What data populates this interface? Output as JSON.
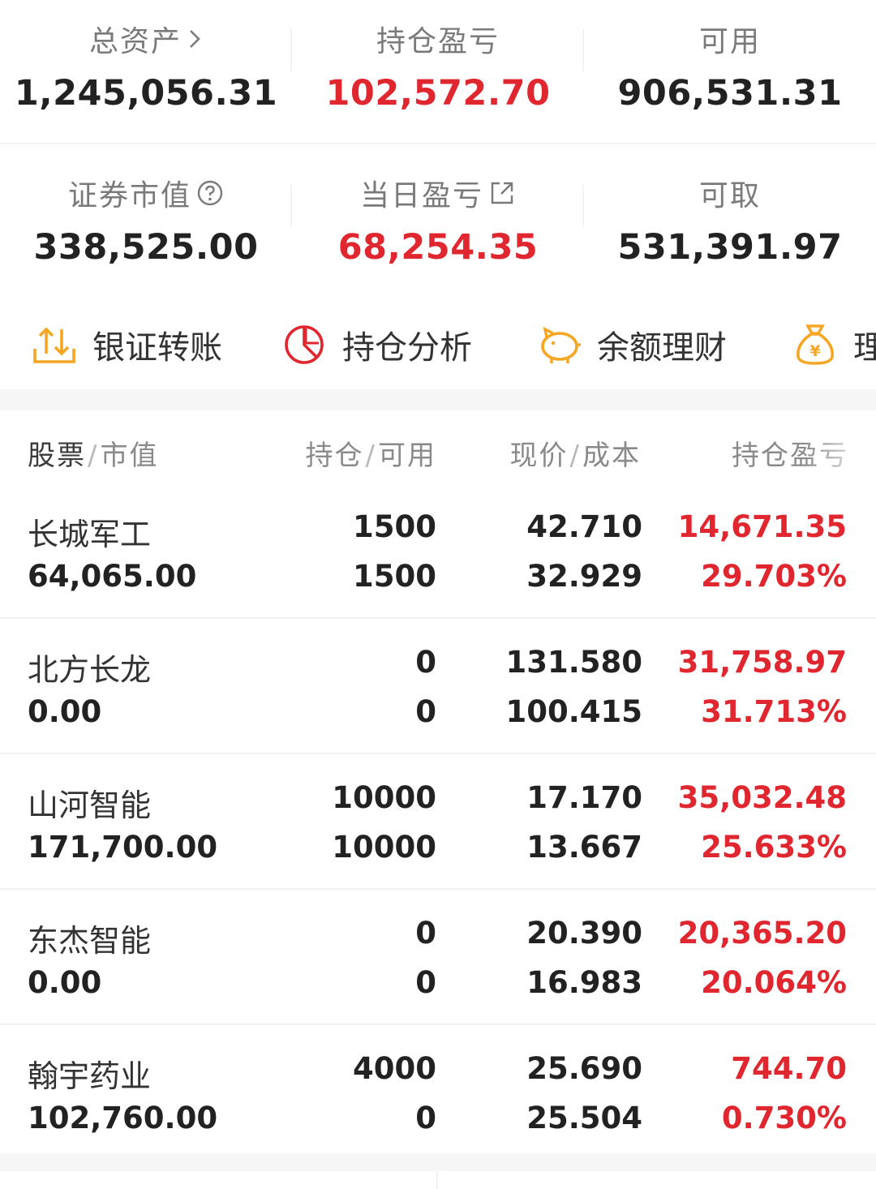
{
  "summary": {
    "total_assets": {
      "label": "总资产",
      "value": "1,245,056.31"
    },
    "position_pnl": {
      "label": "持仓盈亏",
      "value": "102,572.70"
    },
    "available": {
      "label": "可用",
      "value": "906,531.31"
    },
    "securities_value": {
      "label": "证券市值",
      "value": "338,525.00"
    },
    "daily_pnl": {
      "label": "当日盈亏",
      "value": "68,254.35"
    },
    "withdrawable": {
      "label": "可取",
      "value": "531,391.97"
    }
  },
  "actions": [
    {
      "label": "银证转账",
      "icon": "transfer-icon"
    },
    {
      "label": "持仓分析",
      "icon": "pie-chart-icon"
    },
    {
      "label": "余额理财",
      "icon": "piggy-bank-icon"
    },
    {
      "label": "理财",
      "icon": "money-bag-icon"
    }
  ],
  "table": {
    "headers": {
      "c1a": "股票",
      "c1b": "市值",
      "c2a": "持仓",
      "c2b": "可用",
      "c3a": "现价",
      "c3b": "成本",
      "c4": "持仓盈亏"
    },
    "rows": [
      {
        "name": "长城军工",
        "market_value": "64,065.00",
        "holding": "1500",
        "available": "1500",
        "price": "42.710",
        "cost": "32.929",
        "pnl": "14,671.35",
        "pnl_pct": "29.703%"
      },
      {
        "name": "北方长龙",
        "market_value": "0.00",
        "holding": "0",
        "available": "0",
        "price": "131.580",
        "cost": "100.415",
        "pnl": "31,758.97",
        "pnl_pct": "31.713%"
      },
      {
        "name": "山河智能",
        "market_value": "171,700.00",
        "holding": "10000",
        "available": "10000",
        "price": "17.170",
        "cost": "13.667",
        "pnl": "35,032.48",
        "pnl_pct": "25.633%"
      },
      {
        "name": "东杰智能",
        "market_value": "0.00",
        "holding": "0",
        "available": "0",
        "price": "20.390",
        "cost": "16.983",
        "pnl": "20,365.20",
        "pnl_pct": "20.064%"
      },
      {
        "name": "翰宇药业",
        "market_value": "102,760.00",
        "holding": "4000",
        "available": "0",
        "price": "25.690",
        "cost": "25.504",
        "pnl": "744.70",
        "pnl_pct": "0.730%"
      }
    ]
  },
  "colors": {
    "profit_red": "#e0262e",
    "icon_orange": "#f5a623",
    "icon_red": "#e0262e"
  }
}
